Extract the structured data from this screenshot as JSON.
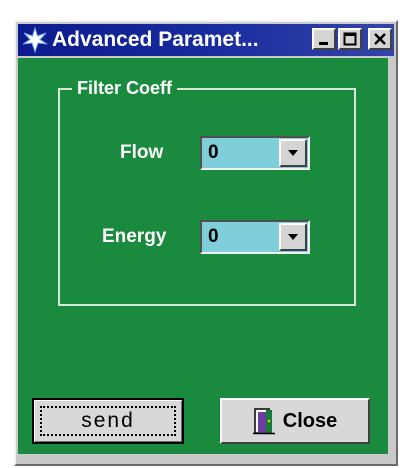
{
  "window": {
    "title": "Advanced Paramet...",
    "app_icon": "star-burst-icon",
    "controls": {
      "minimize_icon": "minimize-icon",
      "maximize_icon": "maximize-icon",
      "close_icon": "close-x-icon"
    }
  },
  "filter_group": {
    "label": "Filter Coeff",
    "fields": [
      {
        "label": "Flow",
        "value": "0"
      },
      {
        "label": "Energy",
        "value": "0"
      }
    ]
  },
  "buttons": {
    "send_label": "send",
    "close_label": "Close",
    "close_icon": "door-exit-icon"
  },
  "colors": {
    "background": "#1a8a3f",
    "titlebar": "#0b1a8c",
    "combo": "#7ecfd9"
  }
}
